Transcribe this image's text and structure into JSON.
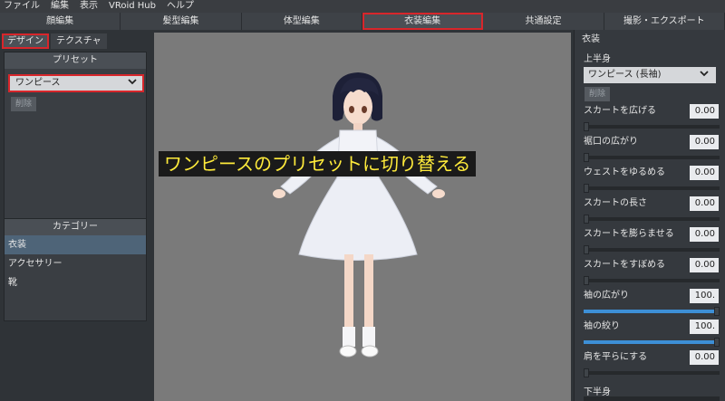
{
  "menubar": {
    "items": [
      "ファイル",
      "編集",
      "表示",
      "VRoid Hub",
      "ヘルプ"
    ]
  },
  "tabs": [
    "顔編集",
    "髪型編集",
    "体型編集",
    "衣装編集",
    "共通設定",
    "撮影・エクスポート"
  ],
  "active_tab_index": 3,
  "left": {
    "subtabs": [
      "デザイン",
      "テクスチャ"
    ],
    "preset_header": "プリセット",
    "preset_selected": "ワンピース",
    "delete_label": "削除",
    "category_header": "カテゴリー",
    "categories": [
      "衣装",
      "アクセサリー",
      "靴"
    ],
    "active_category_index": 0
  },
  "caption": "ワンピースのプリセットに切り替える",
  "right": {
    "section_title": "衣装",
    "upper_label": "上半身",
    "garment_selected": "ワンピース (長袖)",
    "delete_label": "削除",
    "params": [
      {
        "label": "スカートを広げる",
        "value": "0.00",
        "fill": 0
      },
      {
        "label": "裾口の広がり",
        "value": "0.00",
        "fill": 0
      },
      {
        "label": "ウェストをゆるめる",
        "value": "0.00",
        "fill": 0
      },
      {
        "label": "スカートの長さ",
        "value": "0.00",
        "fill": 0
      },
      {
        "label": "スカートを膨らませる",
        "value": "0.00",
        "fill": 0
      },
      {
        "label": "スカートをすぼめる",
        "value": "0.00",
        "fill": 0
      },
      {
        "label": "袖の広がり",
        "value": "100.",
        "fill": 1
      },
      {
        "label": "袖の絞り",
        "value": "100.",
        "fill": 1
      },
      {
        "label": "肩を平らにする",
        "value": "0.00",
        "fill": 0
      }
    ],
    "lower_label": "下半身"
  },
  "colors": {
    "highlight_red": "#d8262b",
    "slider_blue": "#3d8fd6",
    "caption_yellow": "#ffeb3b"
  }
}
